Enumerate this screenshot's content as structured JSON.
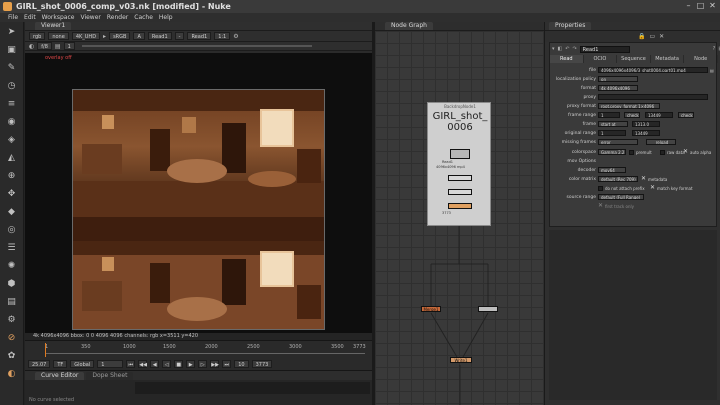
{
  "window": {
    "title": "GIRL_shot_0006_comp_v03.nk [modified] - Nuke"
  },
  "menu": [
    "File",
    "Edit",
    "Workspace",
    "Viewer",
    "Render",
    "Cache",
    "Help"
  ],
  "viewer": {
    "tab": "Viewer1",
    "channels": "rgb",
    "alpha": "none",
    "resolution": "4K_UHD",
    "colorspace": "sRGB",
    "input_a": "A",
    "input_a_node": "Read1",
    "input_b_node": "Read1",
    "zoom": "1:1",
    "fstop_label": "f/8",
    "frame_label": "1",
    "overlay_warning": "overlay off",
    "info": "4k 4096x4096   bbox: 0 0 4096 4096 channels: rgb   x=3511 y=420"
  },
  "timeline": {
    "ticks": [
      "1",
      "350",
      "1000",
      "1500",
      "2000",
      "2500",
      "3000",
      "3500",
      "3773"
    ],
    "fps": "25.07",
    "fps_mode": "TF",
    "range_mode": "Global",
    "current_frame": "1",
    "end_frame": "3773",
    "step": "10"
  },
  "curve_editor": {
    "tabs": [
      "Curve Editor",
      "Dope Sheet"
    ],
    "footer": "No curve selected"
  },
  "node_graph": {
    "tab": "Node Graph",
    "backdrop_label": "BackdropNode1",
    "backdrop_title": "GIRL_shot_\n0006",
    "read_label": "Read1",
    "read_caption": "4096x4096 mp4",
    "merge_label": "Merge1",
    "write_label": "Write1",
    "frame_caption": "3773"
  },
  "properties": {
    "tab": "Properties",
    "node_name": "Read1",
    "tabs": [
      "Read",
      "OCIO",
      "Sequence",
      "Metadata",
      "Node"
    ],
    "rows": [
      {
        "label": "file",
        "value": "4096x4096x4096/3_shot0004.part01.mp4"
      },
      {
        "label": "localization policy",
        "value": "on"
      },
      {
        "label": "format",
        "value": "4k 4096x4096"
      },
      {
        "label": "proxy",
        "value": ""
      },
      {
        "label": "proxy format",
        "value": "root.proxy_format 1×4096"
      },
      {
        "label": "frame range",
        "value": "1",
        "extra": "check",
        "end": "13449",
        "end_mode": "check"
      },
      {
        "label": "frame",
        "value": "start at",
        "extra": "1",
        "offset": "1313.0"
      },
      {
        "label": "original range",
        "value": "1",
        "end": "13449"
      },
      {
        "label": "missing frames",
        "value": "error",
        "btn": "reload"
      },
      {
        "label": "colorspace",
        "value": "Gamma 2.2",
        "premult": "premult",
        "raw": "raw data",
        "auto": "auto alpha"
      },
      {
        "label": "mov Options",
        "value": ""
      },
      {
        "label": "decoder",
        "value": "mov64"
      },
      {
        "label": "color matrix",
        "value": "default (Rec 709)",
        "meta": "metadata"
      },
      {
        "label": "",
        "value": "do not attach prefix",
        "match": "match key format"
      },
      {
        "label": "source range",
        "value": "default (Full Range)"
      },
      {
        "label": "",
        "value": "first track only"
      }
    ]
  }
}
